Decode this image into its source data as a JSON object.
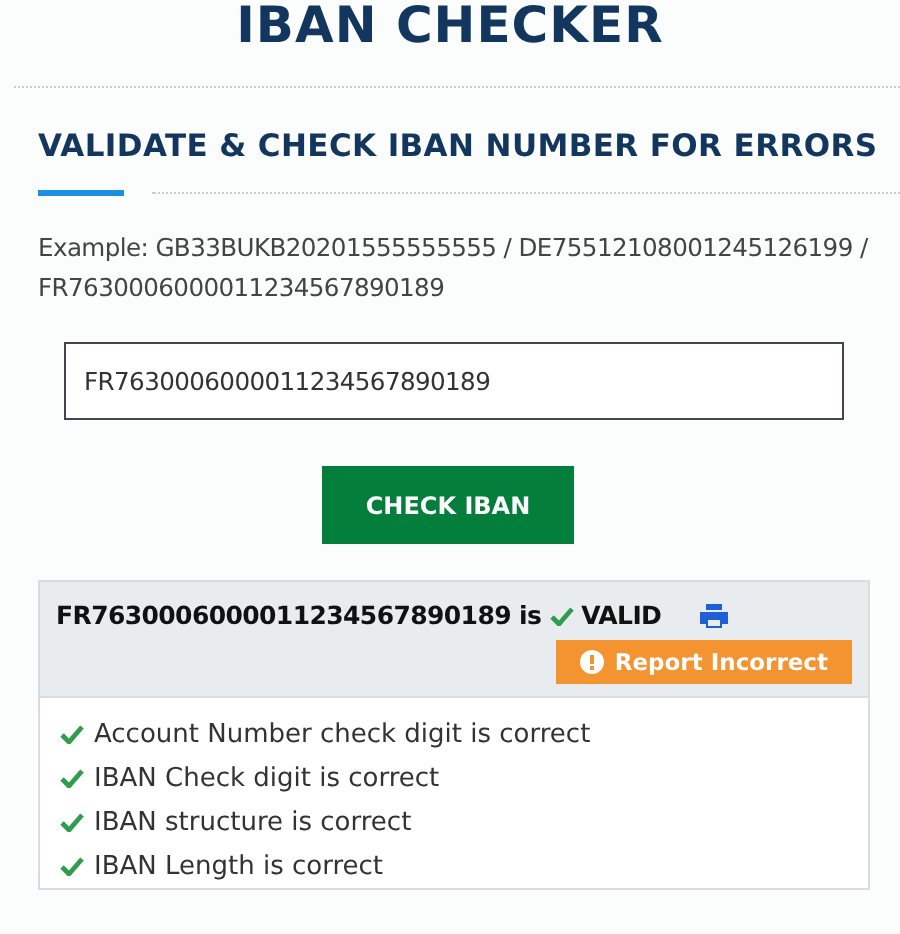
{
  "title": "IBAN CHECKER",
  "heading": "VALIDATE & CHECK IBAN NUMBER FOR ERRORS",
  "example": "Example: GB33BUKB20201555555555 / DE75512108001245126199 / FR7630006000011234567890189",
  "iban_field": {
    "value": "FR7630006000011234567890189"
  },
  "check_button": "CHECK IBAN",
  "result": {
    "iban": "FR7630006000011234567890189",
    "is": "is",
    "valid": true,
    "status": "VALID",
    "report_button": "Report Incorrect",
    "checks": [
      {
        "text": "Account Number check digit is correct",
        "passed": true
      },
      {
        "text": "IBAN Check digit is correct",
        "passed": true
      },
      {
        "text": "IBAN structure is correct",
        "passed": true
      },
      {
        "text": "IBAN Length is correct",
        "passed": true
      }
    ]
  }
}
